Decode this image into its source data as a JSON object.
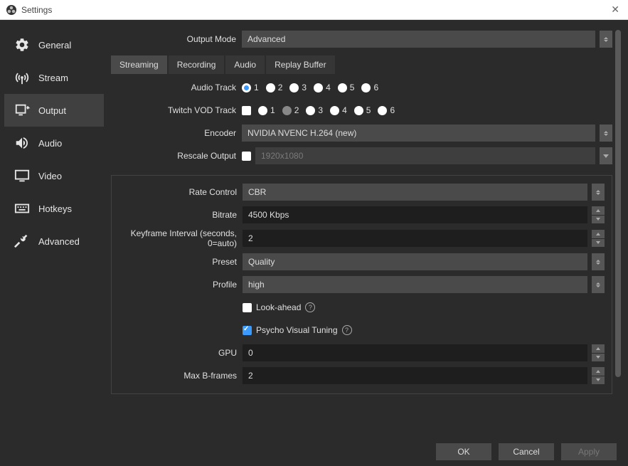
{
  "window": {
    "title": "Settings"
  },
  "sidebar": {
    "items": [
      {
        "label": "General"
      },
      {
        "label": "Stream"
      },
      {
        "label": "Output"
      },
      {
        "label": "Audio"
      },
      {
        "label": "Video"
      },
      {
        "label": "Hotkeys"
      },
      {
        "label": "Advanced"
      }
    ],
    "selected": "Output"
  },
  "output_mode": {
    "label": "Output Mode",
    "value": "Advanced"
  },
  "tabs": {
    "items": [
      {
        "label": "Streaming"
      },
      {
        "label": "Recording"
      },
      {
        "label": "Audio"
      },
      {
        "label": "Replay Buffer"
      }
    ],
    "active": "Streaming"
  },
  "audio_track": {
    "label": "Audio Track",
    "options": [
      "1",
      "2",
      "3",
      "4",
      "5",
      "6"
    ],
    "selected": "1"
  },
  "twitch_vod_track": {
    "label": "Twitch VOD Track",
    "enabled": false,
    "options": [
      "1",
      "2",
      "3",
      "4",
      "5",
      "6"
    ],
    "selected": "2"
  },
  "encoder": {
    "label": "Encoder",
    "value": "NVIDIA NVENC H.264 (new)"
  },
  "rescale": {
    "label": "Rescale Output",
    "enabled": false,
    "value": "1920x1080"
  },
  "rate_control": {
    "label": "Rate Control",
    "value": "CBR"
  },
  "bitrate": {
    "label": "Bitrate",
    "value": "4500 Kbps"
  },
  "keyframe": {
    "label": "Keyframe Interval (seconds, 0=auto)",
    "value": "2"
  },
  "preset": {
    "label": "Preset",
    "value": "Quality"
  },
  "profile": {
    "label": "Profile",
    "value": "high"
  },
  "look_ahead": {
    "label": "Look-ahead",
    "checked": false
  },
  "psycho": {
    "label": "Psycho Visual Tuning",
    "checked": true
  },
  "gpu": {
    "label": "GPU",
    "value": "0"
  },
  "max_bframes": {
    "label": "Max B-frames",
    "value": "2"
  },
  "footer": {
    "ok": "OK",
    "cancel": "Cancel",
    "apply": "Apply"
  }
}
